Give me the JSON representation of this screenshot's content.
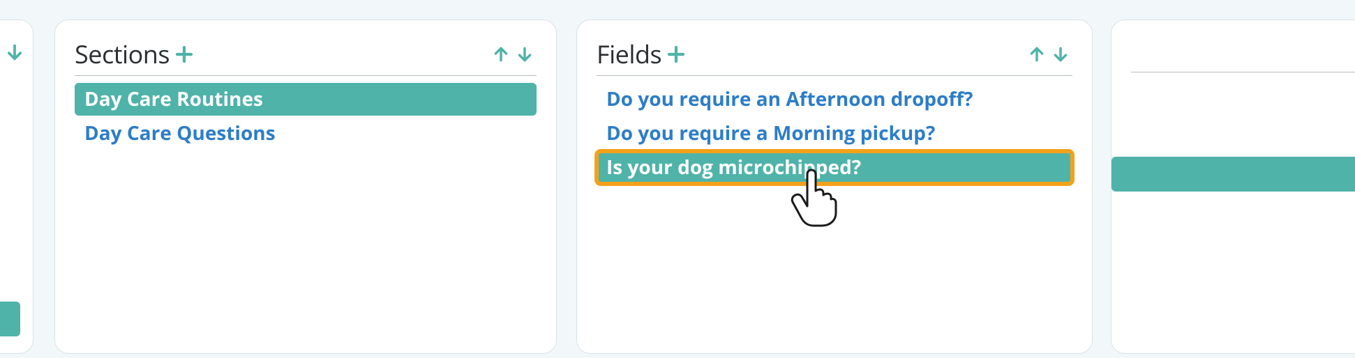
{
  "colors": {
    "teal": "#4fb3a9",
    "link": "#2d7dc8",
    "highlight": "#f4a11a",
    "page_bg": "#f2f8fa"
  },
  "panels": {
    "sections": {
      "title": "Sections",
      "add_label": "Add section",
      "move_up_label": "Move up",
      "move_down_label": "Move down",
      "items": [
        {
          "label": "Day Care Routines",
          "selected": true
        },
        {
          "label": "Day Care Questions",
          "selected": false
        }
      ]
    },
    "fields": {
      "title": "Fields",
      "add_label": "Add field",
      "move_up_label": "Move up",
      "move_down_label": "Move down",
      "items": [
        {
          "label": "Do you require an Afternoon dropoff?",
          "selected": false,
          "highlighted": false
        },
        {
          "label": "Do you require a Morning pickup?",
          "selected": false,
          "highlighted": false
        },
        {
          "label": "Is your dog microchipped?",
          "selected": true,
          "highlighted": true
        }
      ]
    }
  }
}
